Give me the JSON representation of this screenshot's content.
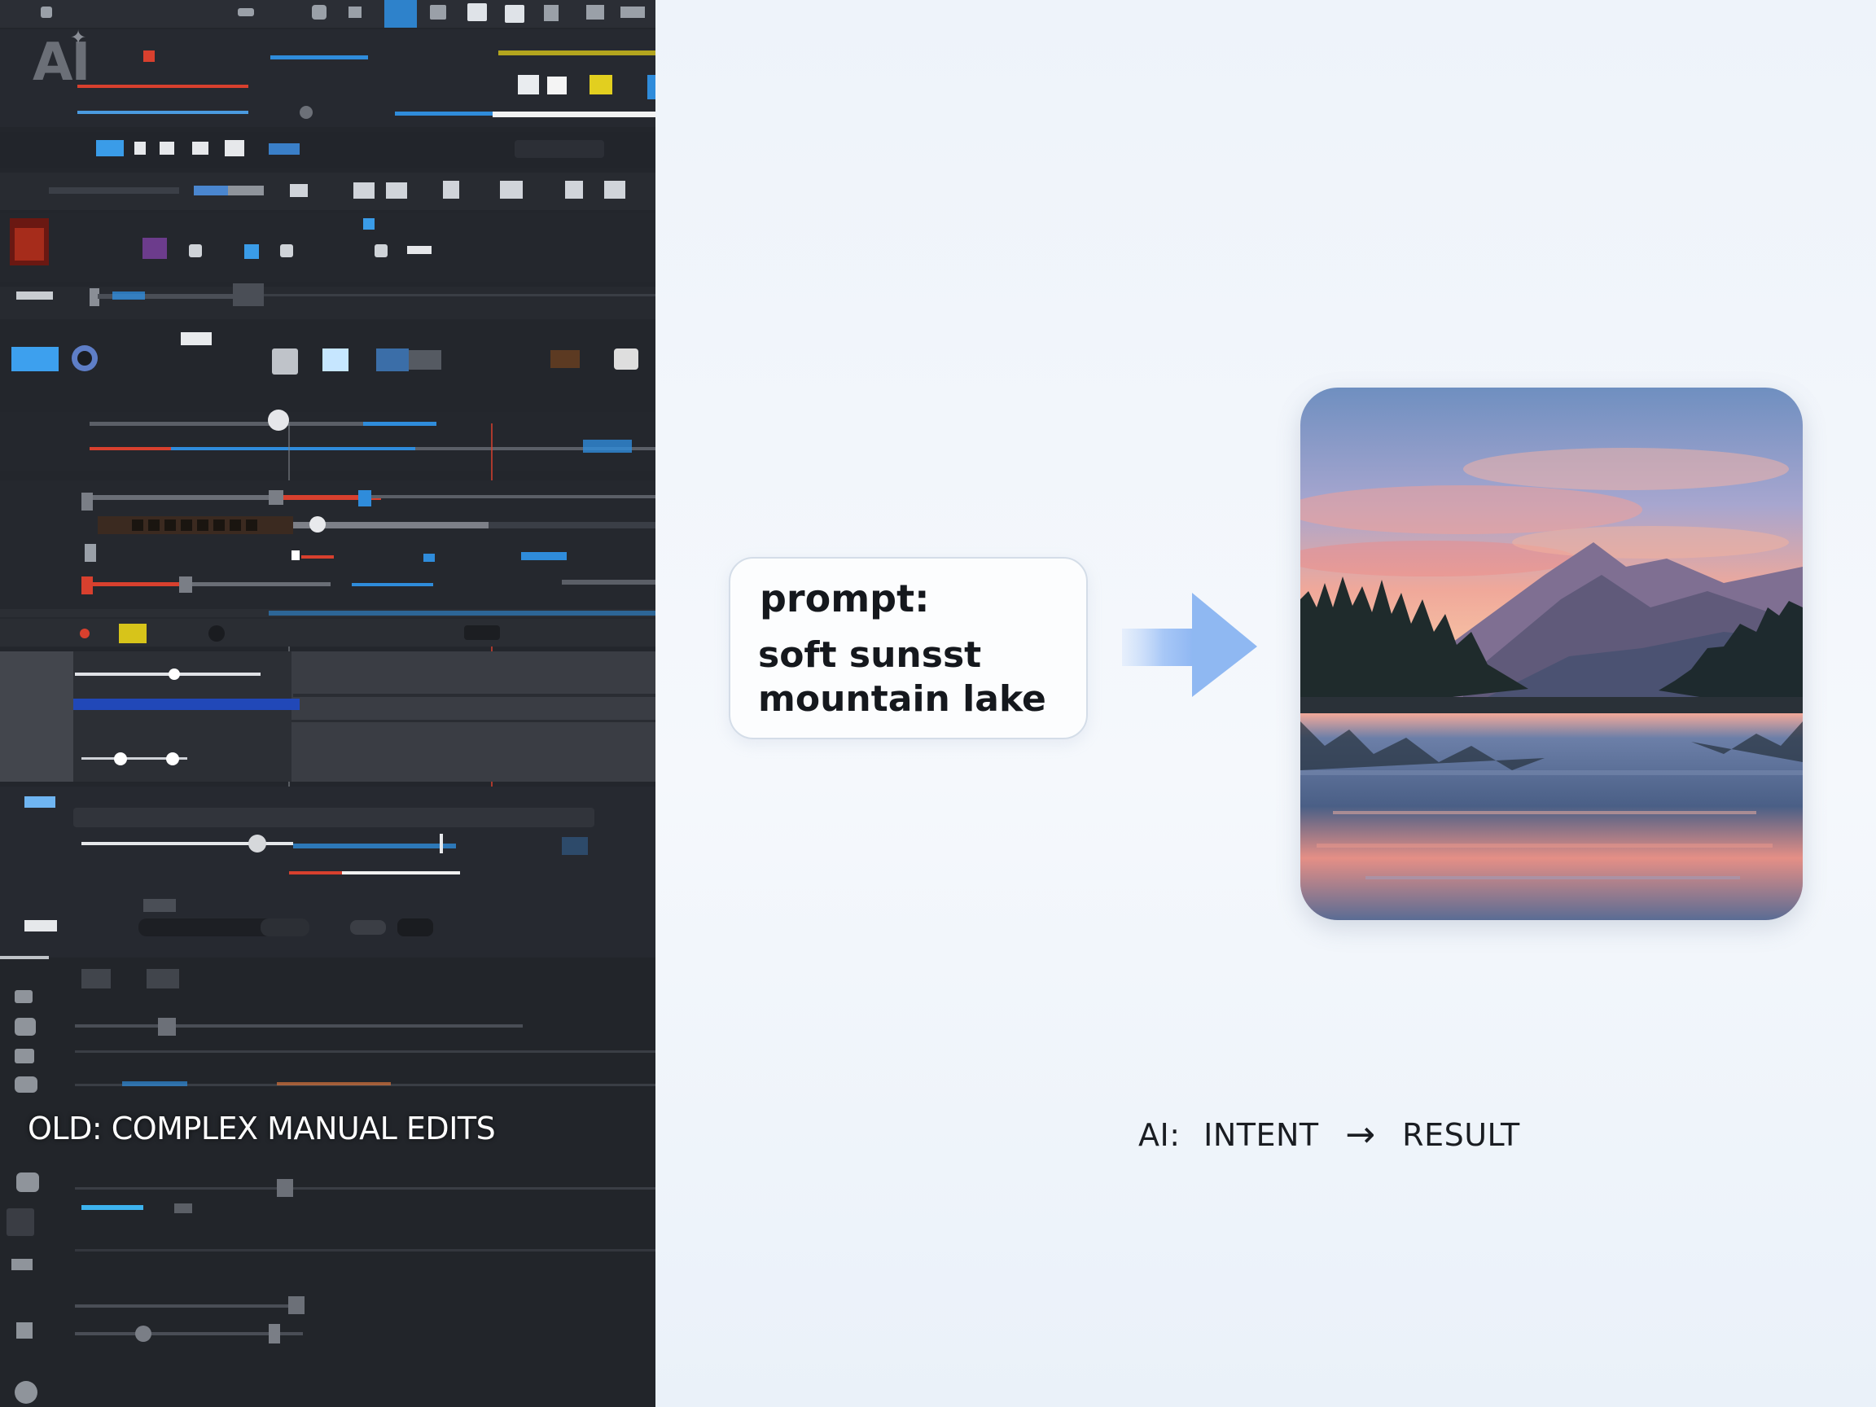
{
  "left_panel": {
    "logo_text": "AI",
    "label": "OLD: COMPLEX MANUAL EDITS"
  },
  "prompt_card": {
    "title": "prompt:",
    "text": "soft sunsst mountain lake"
  },
  "bottom_label": {
    "left": "AI:",
    "middle": "INTENT",
    "arrow": "→",
    "right": "RESULT"
  },
  "colors": {
    "editor_bg": "#23262c",
    "accent_blue": "#2f8cdb",
    "accent_red": "#d8402e",
    "accent_yellow": "#d7c41a",
    "arrow_blue": "#8fb8f2"
  },
  "icons": [
    "sparkle-icon",
    "arrow-right-icon"
  ]
}
